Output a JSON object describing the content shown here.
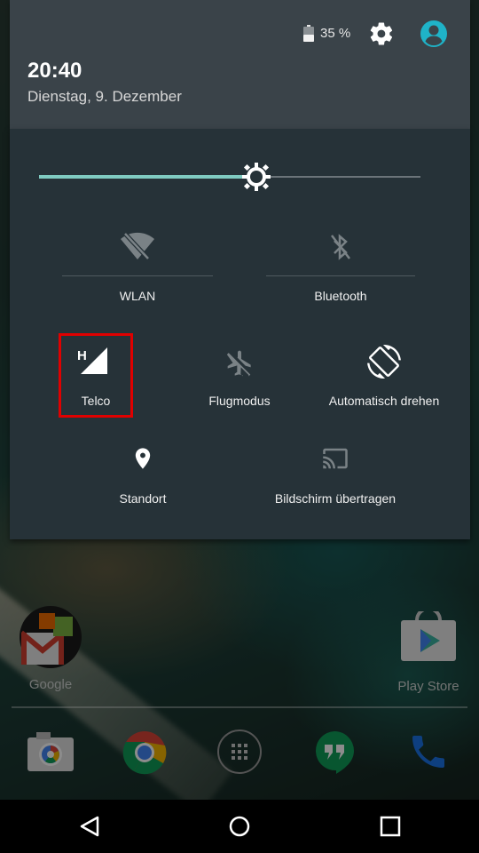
{
  "status": {
    "battery_text": "35 %",
    "battery_icon": "battery-icon",
    "settings_icon": "gear-icon",
    "profile_icon": "account-circle-icon",
    "profile_color": "#1fb3c8"
  },
  "header": {
    "time": "20:40",
    "date": "Dienstag, 9. Dezember"
  },
  "brightness": {
    "level_fraction": 0.57,
    "accent_color": "#7fcbc1"
  },
  "tiles": [
    {
      "label": "WLAN",
      "icon": "wifi-off-icon"
    },
    {
      "label": "Bluetooth",
      "icon": "bluetooth-off-icon"
    },
    {
      "label": "Telco",
      "icon": "cellular-signal-icon",
      "badge": "H"
    },
    {
      "label": "Flugmodus",
      "icon": "airplane-off-icon"
    },
    {
      "label": "Automatisch drehen",
      "icon": "auto-rotate-icon"
    },
    {
      "label": "Standort",
      "icon": "location-icon"
    },
    {
      "label": "Bildschirm übertragen",
      "icon": "cast-icon"
    }
  ],
  "apps": {
    "google_folder": "Google",
    "play_store": "Play Store"
  },
  "dock": [
    "camera-icon",
    "chrome-icon",
    "app-drawer-icon",
    "hangouts-icon",
    "phone-icon"
  ],
  "navbar": [
    "back-icon",
    "home-icon",
    "recents-icon"
  ],
  "highlight_color": "#e00000"
}
